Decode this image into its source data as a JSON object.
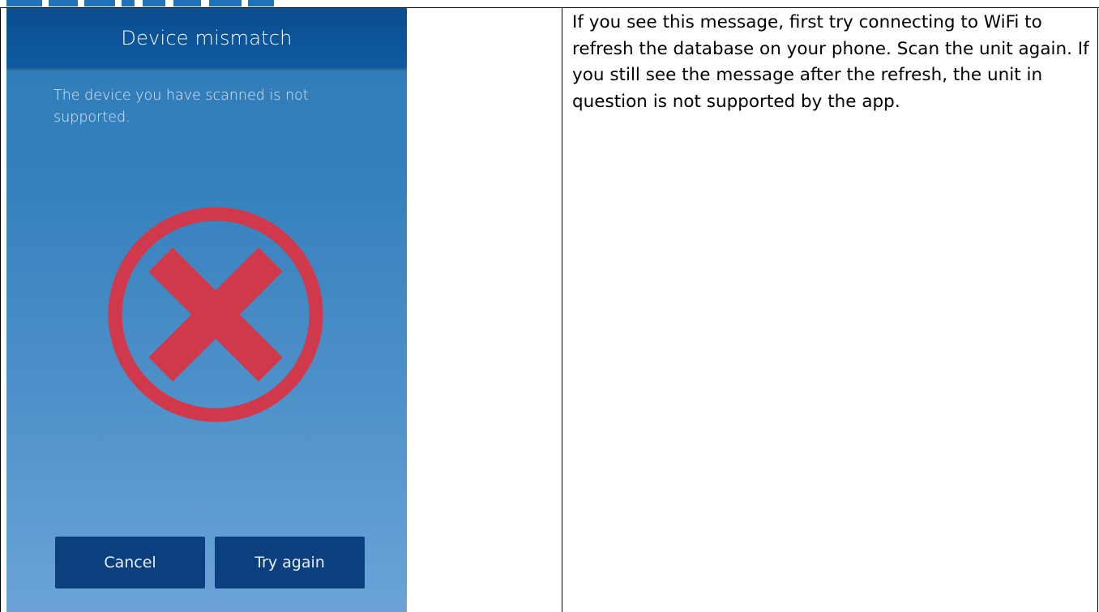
{
  "phone_screen": {
    "title": "Device mismatch",
    "message": "The device you have scanned is not supported.",
    "icon": "error-x-circle-icon",
    "buttons": {
      "cancel_label": "Cancel",
      "retry_label": "Try again"
    }
  },
  "instructions": {
    "text": "If you see this message, first try connecting to WiFi to refresh the database on your phone. Scan the unit again. If you still see the message after the refresh, the unit in question is not supported by the app."
  },
  "colors": {
    "header": "#0e5aa2",
    "background_top": "#2e7bb8",
    "background_bottom": "#6ba3d8",
    "button": "#0b3f7d",
    "error_red": "#d0394c",
    "logo_blue": "#1e73b9"
  }
}
